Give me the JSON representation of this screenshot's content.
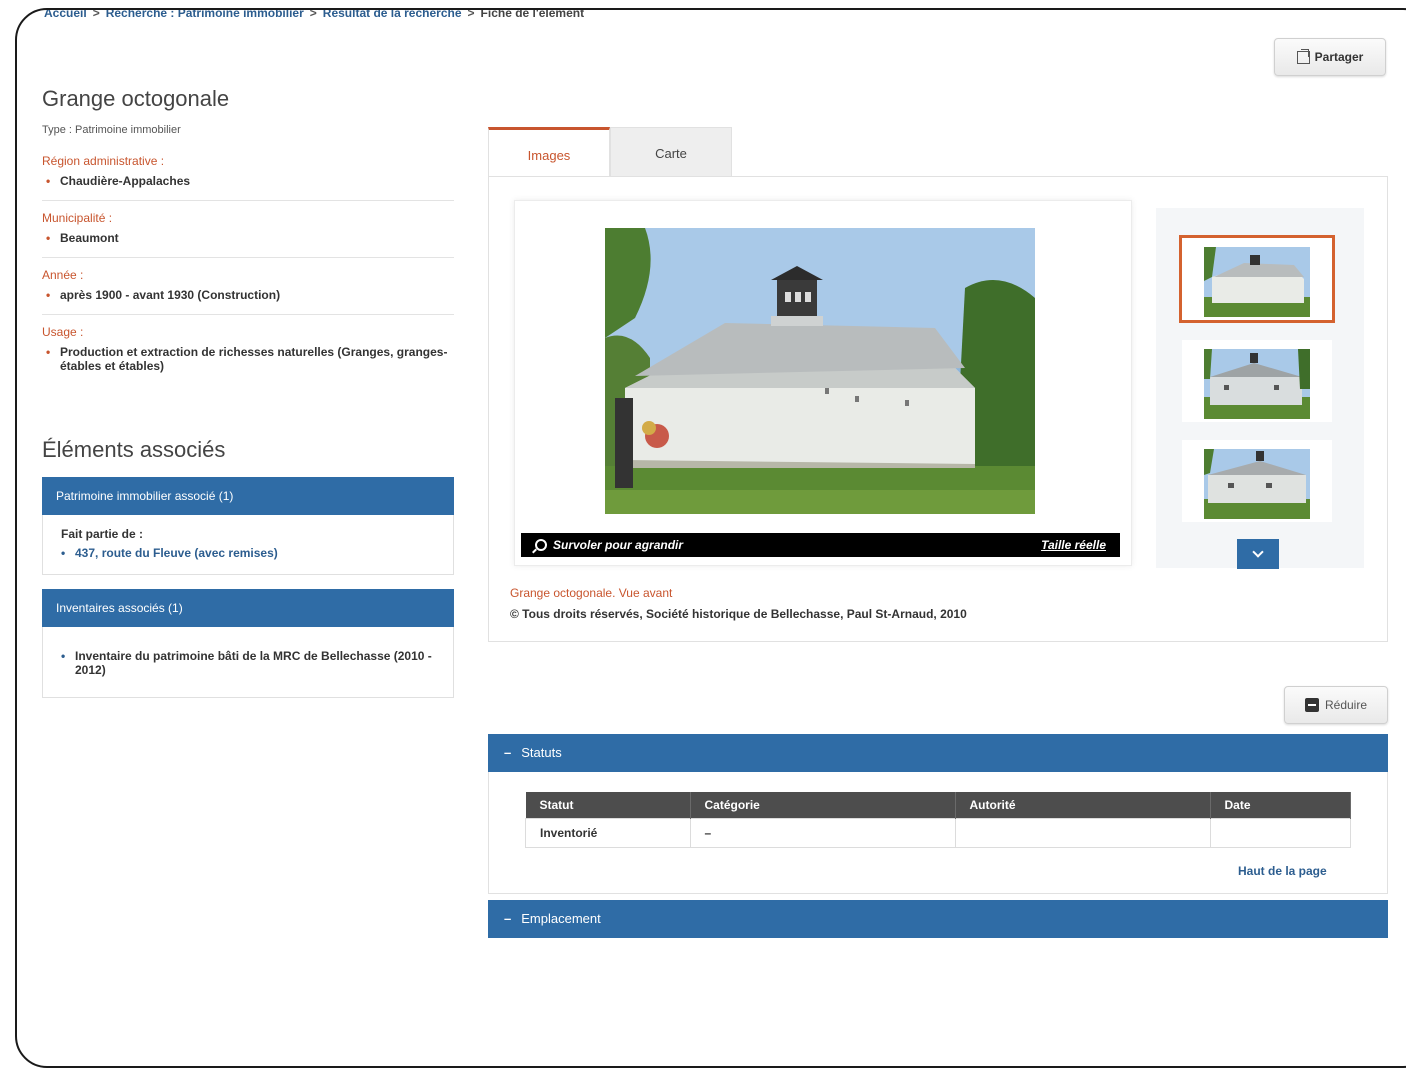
{
  "breadcrumb": {
    "items": [
      "Accueil",
      "Recherche : Patrimoine immobilier",
      "Résultat de la recherche",
      "Fiche de l'élément"
    ]
  },
  "share_label": "Partager",
  "element": {
    "title": "Grange octogonale",
    "type_line": "Type : Patrimoine immobilier",
    "fields": [
      {
        "label": "Région administrative :",
        "value": "Chaudière-Appalaches"
      },
      {
        "label": "Municipalité :",
        "value": "Beaumont"
      },
      {
        "label": "Année :",
        "value": "après 1900 - avant 1930 (Construction)"
      },
      {
        "label": "Usage :",
        "value": "Production et extraction de richesses naturelles (Granges, granges-étables et étables)"
      }
    ]
  },
  "associated": {
    "title": "Éléments associés",
    "immobilier": {
      "header": "Patrimoine immobilier associé (1)",
      "sub": "Fait partie de :",
      "link": "437, route du Fleuve (avec remises)"
    },
    "inventaires": {
      "header": "Inventaires associés (1)",
      "item": "Inventaire du patrimoine bâti de la MRC de Bellechasse (2010 - 2012)"
    }
  },
  "tabs": [
    {
      "label": "Images",
      "active": true
    },
    {
      "label": "Carte",
      "active": false
    }
  ],
  "viewer": {
    "zoom_hint": "Survoler pour agrandir",
    "full_size": "Taille réelle",
    "caption_title": "Grange octogonale. Vue avant",
    "caption_credit": "© Tous droits réservés, Société historique de Bellechasse, Paul St-Arnaud, 2010"
  },
  "reduce_label": "Réduire",
  "statuts": {
    "header": "Statuts",
    "columns": [
      "Statut",
      "Catégorie",
      "Autorité",
      "Date"
    ],
    "rows": [
      [
        "Inventorié",
        "–",
        "",
        ""
      ]
    ],
    "top_link": "Haut de la page"
  },
  "emplacement": {
    "header": "Emplacement"
  },
  "colors": {
    "accent": "#c8552e",
    "primary": "#2f6ca6",
    "table_head": "#4d4d4d"
  }
}
